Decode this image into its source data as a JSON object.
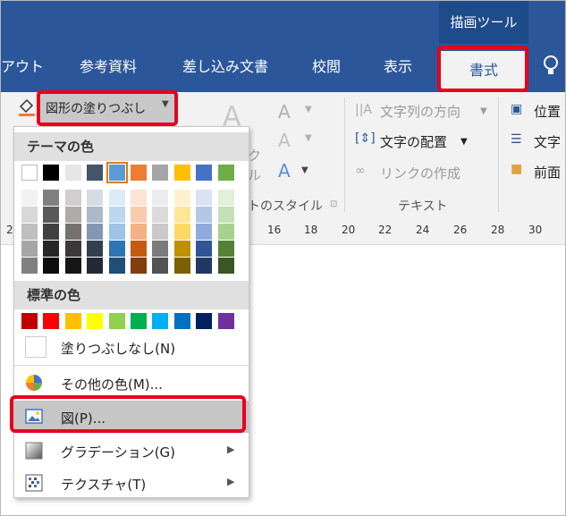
{
  "header": {
    "context_label": "描画ツール",
    "tabs": [
      "アウト",
      "参考資料",
      "差し込み文書",
      "校閲",
      "表示"
    ],
    "active_tab": "書式",
    "help_icon": "lightbulb-icon"
  },
  "ribbon": {
    "shape_fill_label": "図形の塗りつぶし",
    "wordart_styles_label": "トのスタイル",
    "text_group_label": "テキスト",
    "text_direction": "文字列の方向",
    "text_align": "文字の配置",
    "create_link": "リンクの作成",
    "position": "位置",
    "wrap_text": "文字",
    "bring_forward": "前面",
    "partial_text_1": "ク",
    "partial_text_2": "ル",
    "big_a": "A"
  },
  "ruler": {
    "ticks": [
      "2",
      "16",
      "18",
      "20",
      "22",
      "24",
      "26",
      "28",
      "30"
    ]
  },
  "menu": {
    "theme_colors_label": "テーマの色",
    "theme_top": [
      "#ffffff",
      "#000000",
      "#e7e6e6",
      "#44546a",
      "#5b9bd5",
      "#ed7d31",
      "#a5a5a5",
      "#ffc000",
      "#4472c4",
      "#70ad47"
    ],
    "theme_shades": [
      [
        "#f2f2f2",
        "#d9d9d9",
        "#bfbfbf",
        "#a6a6a6",
        "#808080"
      ],
      [
        "#808080",
        "#595959",
        "#404040",
        "#262626",
        "#0d0d0d"
      ],
      [
        "#d0cece",
        "#aeabab",
        "#757171",
        "#3a3838",
        "#171616"
      ],
      [
        "#d6dce4",
        "#acb9ca",
        "#8497b0",
        "#323f4f",
        "#222a35"
      ],
      [
        "#ddebf7",
        "#bdd7ee",
        "#9dc3e6",
        "#2e75b6",
        "#1f4e79"
      ],
      [
        "#fbe5d6",
        "#f8cbad",
        "#f4b183",
        "#c55a11",
        "#843c0c"
      ],
      [
        "#ededed",
        "#dbdbdb",
        "#c9c9c9",
        "#7b7b7b",
        "#525252"
      ],
      [
        "#fff2cc",
        "#ffe699",
        "#ffd966",
        "#bf9000",
        "#7f6000"
      ],
      [
        "#dae3f3",
        "#b4c7e7",
        "#8faadc",
        "#2f5597",
        "#203864"
      ],
      [
        "#e2f0d9",
        "#c5e0b4",
        "#a9d18e",
        "#548235",
        "#385723"
      ]
    ],
    "standard_colors_label": "標準の色",
    "standard_colors": [
      "#c00000",
      "#ff0000",
      "#ffc000",
      "#ffff00",
      "#92d050",
      "#00b050",
      "#00b0f0",
      "#0070c0",
      "#002060",
      "#7030a0"
    ],
    "no_fill": "塗りつぶしなし(N)",
    "more_colors": "その他の色(M)...",
    "picture": "図(P)...",
    "gradient": "グラデーション(G)",
    "texture": "テクスチャ(T)"
  }
}
